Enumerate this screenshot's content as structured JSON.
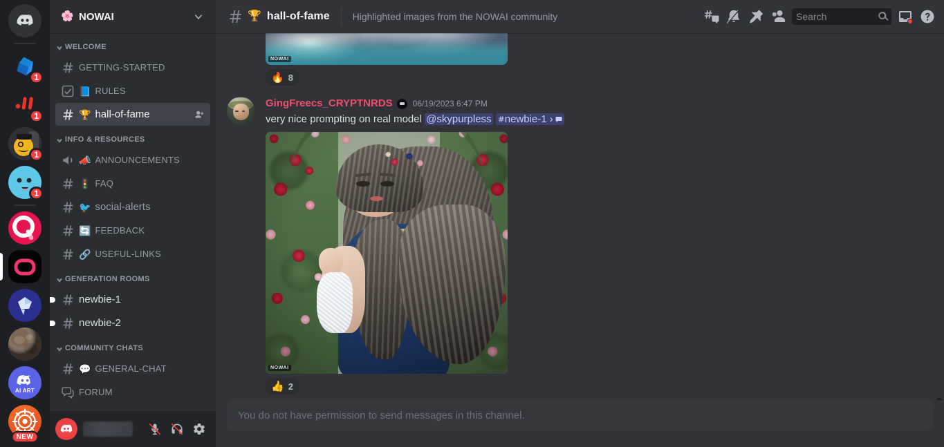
{
  "rail": {
    "servers": [
      {
        "name": "discord-home",
        "label": "",
        "badge": null,
        "shape": "circle",
        "kind": "discord"
      },
      {
        "name": "server-blue-shape",
        "label": "",
        "badge": "1",
        "shape": "rounded",
        "kind": "blueshape"
      },
      {
        "name": "server-red-marks",
        "label": "",
        "badge": "1",
        "shape": "rounded",
        "kind": "redmarks"
      },
      {
        "name": "server-mustache",
        "label": "",
        "badge": "1",
        "shape": "circle",
        "kind": "mustache"
      },
      {
        "name": "server-blue-face",
        "label": "",
        "badge": "1",
        "shape": "circle",
        "kind": "blueface"
      },
      {
        "name": "server-q-logo",
        "label": "",
        "badge": null,
        "shape": "circle",
        "kind": "qlogo"
      },
      {
        "name": "server-black-o",
        "label": "",
        "badge": null,
        "shape": "rounded",
        "kind": "blacko",
        "active": true
      },
      {
        "name": "server-crystal",
        "label": "",
        "badge": null,
        "shape": "circle",
        "kind": "crystal"
      },
      {
        "name": "server-planet",
        "label": "",
        "badge": null,
        "shape": "circle",
        "kind": "planet"
      },
      {
        "name": "server-ai-art",
        "label": "AI ART",
        "badge": null,
        "shape": "circle",
        "kind": "aiart"
      },
      {
        "name": "server-orange-target",
        "label": "",
        "badge": null,
        "shape": "circle",
        "kind": "target",
        "new_badge": "NEW"
      }
    ]
  },
  "sidebar": {
    "server_name": "NOWAI",
    "server_emoji": "🌸",
    "categories": [
      {
        "label": "WELCOME",
        "channels": [
          {
            "name": "GETTING-STARTED",
            "emoji": "",
            "type": "text",
            "small": true
          },
          {
            "name": "RULES",
            "emoji": "📘",
            "type": "rules",
            "small": true
          },
          {
            "name": "hall-of-fame",
            "emoji": "🏆",
            "type": "text",
            "active": true,
            "action": "add-member",
            "small": false
          }
        ]
      },
      {
        "label": "INFO & RESOURCES",
        "channels": [
          {
            "name": "ANNOUNCEMENTS",
            "emoji": "📣",
            "type": "announcement",
            "small": true
          },
          {
            "name": "FAQ",
            "emoji": "🚦",
            "type": "text",
            "small": true
          },
          {
            "name": "social-alerts",
            "emoji": "🐦",
            "type": "text",
            "small": false
          },
          {
            "name": "FEEDBACK",
            "emoji": "🔄",
            "type": "text",
            "small": true
          },
          {
            "name": "USEFUL-LINKS",
            "emoji": "🔗",
            "type": "text",
            "small": true
          }
        ]
      },
      {
        "label": "GENERATION ROOMS",
        "channels": [
          {
            "name": "newbie-1",
            "emoji": "",
            "type": "text",
            "unread": true,
            "small": false
          },
          {
            "name": "newbie-2",
            "emoji": "",
            "type": "text",
            "unread": true,
            "small": false
          }
        ]
      },
      {
        "label": "COMMUNITY CHATS",
        "channels": [
          {
            "name": "GENERAL-CHAT",
            "emoji": "💬",
            "type": "text",
            "small": true
          },
          {
            "name": "FORUM",
            "emoji": "",
            "type": "forum",
            "small": true
          }
        ]
      }
    ],
    "user_panel": {
      "mic_icon": "microphone-muted-icon",
      "headphone_icon": "headphone-deafened-icon",
      "settings_icon": "gear-icon"
    }
  },
  "topbar": {
    "channel_emoji": "🏆",
    "channel_name": "hall-of-fame",
    "description": "Highlighted images from the NOWAI community",
    "actions": [
      {
        "name": "threads-icon"
      },
      {
        "name": "notification-bell-off-icon"
      },
      {
        "name": "pinned-messages-icon"
      },
      {
        "name": "member-list-icon"
      }
    ],
    "search": {
      "placeholder": "Search",
      "value": ""
    },
    "inbox_icon": "inbox-icon",
    "help_icon": "help-icon"
  },
  "messages": {
    "previous_attachment": {
      "name": "sky-clouds-image",
      "watermark": "NOWAI",
      "reaction": {
        "emoji": "🔥",
        "count": "8"
      }
    },
    "message": {
      "author": "GingFreecs_CRYPTNRDS",
      "author_color": "#ed4e6e",
      "badge": "original-poster-badge",
      "timestamp": "06/19/2023 6:47 PM",
      "text_before": "very nice prompting on real model",
      "mention_user": "@skypurpless",
      "mention_channel": "newbie-1",
      "attachment": {
        "name": "portrait-flowers-image",
        "watermark": "NOWAI"
      },
      "reaction": {
        "emoji": "👍",
        "count": "2"
      }
    }
  },
  "composer": {
    "disabled_text": "You do not have permission to send messages in this channel."
  }
}
